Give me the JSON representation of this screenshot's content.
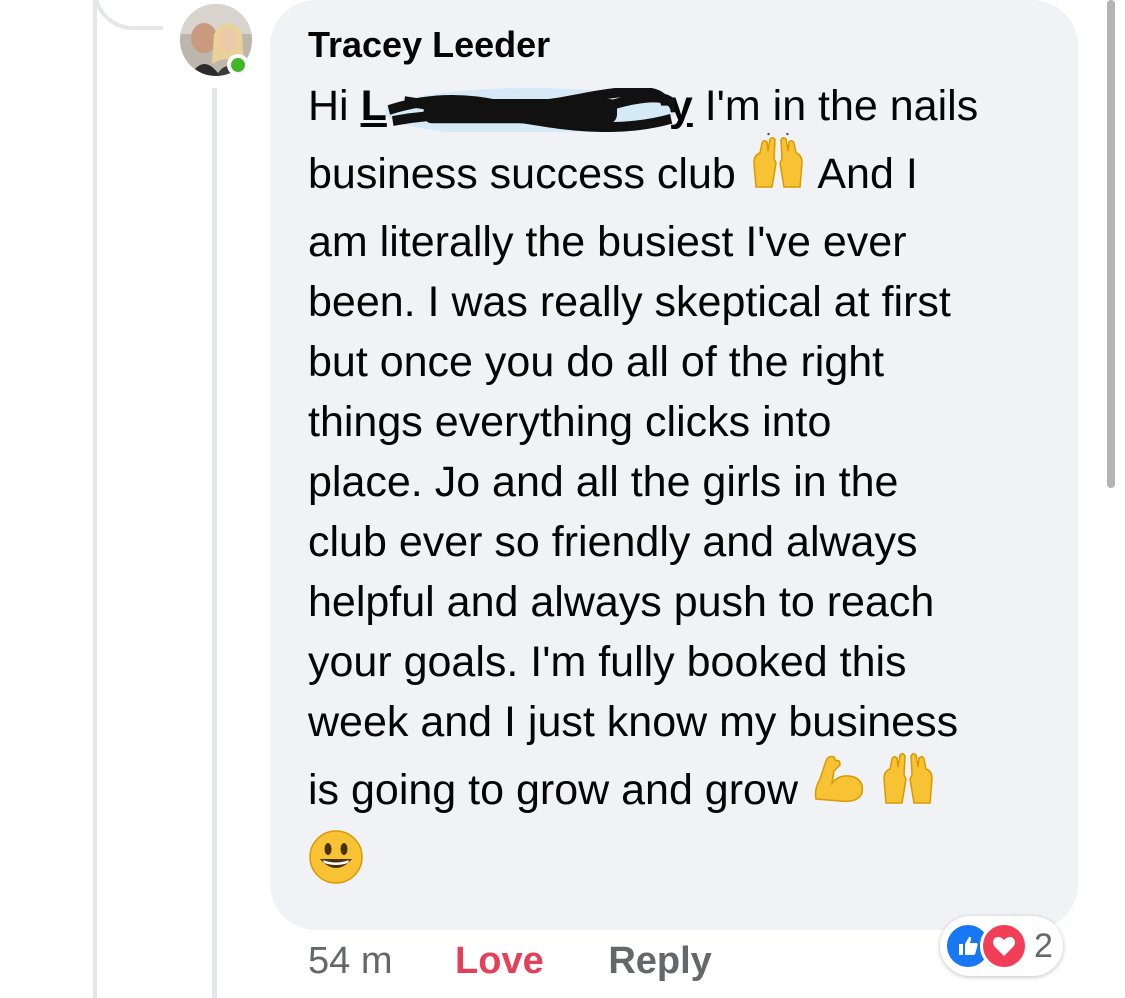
{
  "comment": {
    "author": "Tracey Leeder",
    "greeting": "Hi",
    "mention_visible": "L",
    "mention_tail": "y",
    "lines": {
      "l1_after_mention": " I'm in the nails",
      "l2_before_emoji": "business success club",
      "l2_after_emoji": "And I",
      "l3": "am literally the busiest I've ever",
      "l4": "been. I was really skeptical at first",
      "l5": "but once you do all of the right",
      "l6": "things everything clicks into",
      "l7": "place. Jo and all the girls in the",
      "l8": "club ever so friendly and always",
      "l9": "helpful and always push to reach",
      "l10": "your goals. I'm fully booked this",
      "l11": "week and I just know my business",
      "l12": "is going to grow and grow"
    },
    "emojis": {
      "raising_hands": "raising-hands-emoji",
      "flexed_biceps": "flexed-biceps-emoji",
      "smiley": "grinning-face-emoji"
    }
  },
  "footer": {
    "timestamp": "54 m",
    "love_label": "Love",
    "reply_label": "Reply"
  },
  "reactions": {
    "types": [
      "like",
      "love"
    ],
    "count": "2",
    "colors": {
      "like": "#1877f2",
      "love": "#f33e58"
    }
  },
  "colors": {
    "bubble": "#f0f2f5",
    "text": "#050505",
    "muted": "#65676b",
    "love_accent": "#e4405a",
    "online": "#42b72a"
  }
}
